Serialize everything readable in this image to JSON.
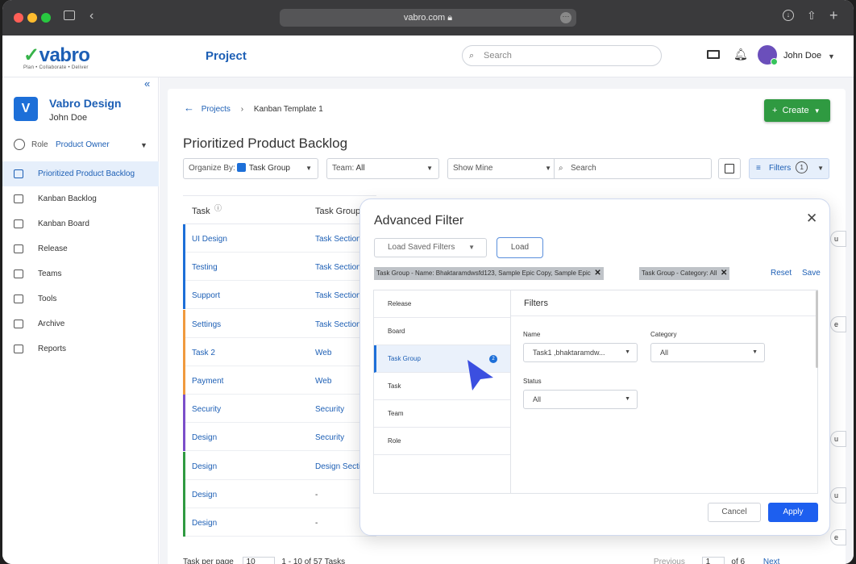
{
  "browser": {
    "url": "vabro.com"
  },
  "header": {
    "brand": "vabro",
    "tagline": "Plan • Collaborate • Deliver",
    "section": "Project",
    "search_placeholder": "Search",
    "user": "John Doe"
  },
  "sidebar": {
    "workspace_initial": "V",
    "workspace_name": "Vabro Design",
    "workspace_user": "John Doe",
    "role_label": "Role",
    "role_value": "Product Owner",
    "items": [
      {
        "label": "Prioritized Product Backlog",
        "icon": "backlog-icon"
      },
      {
        "label": "Kanban Backlog",
        "icon": "list-icon"
      },
      {
        "label": "Kanban Board",
        "icon": "board-icon"
      },
      {
        "label": "Release",
        "icon": "send-icon"
      },
      {
        "label": "Teams",
        "icon": "teams-icon"
      },
      {
        "label": "Tools",
        "icon": "tools-icon"
      },
      {
        "label": "Archive",
        "icon": "archive-icon"
      },
      {
        "label": "Reports",
        "icon": "reports-icon"
      }
    ]
  },
  "main": {
    "breadcrumb": {
      "parent": "Projects",
      "current": "Kanban Template 1"
    },
    "create_label": "Create",
    "title": "Prioritized Product Backlog",
    "organize_label": "Organize By:",
    "organize_value": "Task Group",
    "team_label": "Team:",
    "team_value": "All",
    "show_value": "Show Mine",
    "search_placeholder": "Search",
    "filters_label": "Filters",
    "filters_count": "1",
    "columns": {
      "task": "Task",
      "group": "Task Group"
    },
    "rows": [
      {
        "task": "UI Design",
        "group": "Task Section",
        "color": "#1d6fd8"
      },
      {
        "task": "Testing",
        "group": "Task Section",
        "color": "#1d6fd8"
      },
      {
        "task": "Support",
        "group": "Task Section",
        "color": "#1d6fd8"
      },
      {
        "task": "Settings",
        "group": "Task Section",
        "color": "#f09a3e"
      },
      {
        "task": "Task 2",
        "group": "Web",
        "color": "#f09a3e"
      },
      {
        "task": "Payment",
        "group": "Web",
        "color": "#f09a3e"
      },
      {
        "task": "Security",
        "group": "Security",
        "color": "#7b4fc9"
      },
      {
        "task": "Design",
        "group": "Security",
        "color": "#7b4fc9"
      },
      {
        "task": "Design",
        "group": "Design Section",
        "color": "#2f9a41"
      },
      {
        "task": "Design",
        "group": "-",
        "color": "#2f9a41"
      },
      {
        "task": "Design",
        "group": "-",
        "color": "#2f9a41"
      }
    ],
    "side_badges": [
      "u",
      "e",
      "u",
      "u",
      "e"
    ],
    "pager": {
      "per_page_label": "Task per page",
      "per_page": "10",
      "range": "1 - 10 of 57 Tasks",
      "previous": "Previous",
      "page": "1",
      "of": "of 6",
      "next": "Next"
    }
  },
  "modal": {
    "title": "Advanced Filter",
    "saved_filters_placeholder": "Load Saved Filters",
    "load_label": "Load",
    "chips": [
      "Task Group - Name: Bhaktaramdwsfd123, Sample Epic Copy, Sample Epic",
      "Task Group  - Category: All"
    ],
    "reset_label": "Reset",
    "save_label": "Save",
    "categories": [
      "Release",
      "Board",
      "Task Group",
      "Task",
      "Team",
      "Role"
    ],
    "selected_badge": "2",
    "filters_heading": "Filters",
    "name_label": "Name",
    "name_value": "Task1 ,bhaktaramdw...",
    "category_label": "Category",
    "category_value": "All",
    "status_label": "Status",
    "status_value": "All",
    "cancel_label": "Cancel",
    "apply_label": "Apply"
  }
}
